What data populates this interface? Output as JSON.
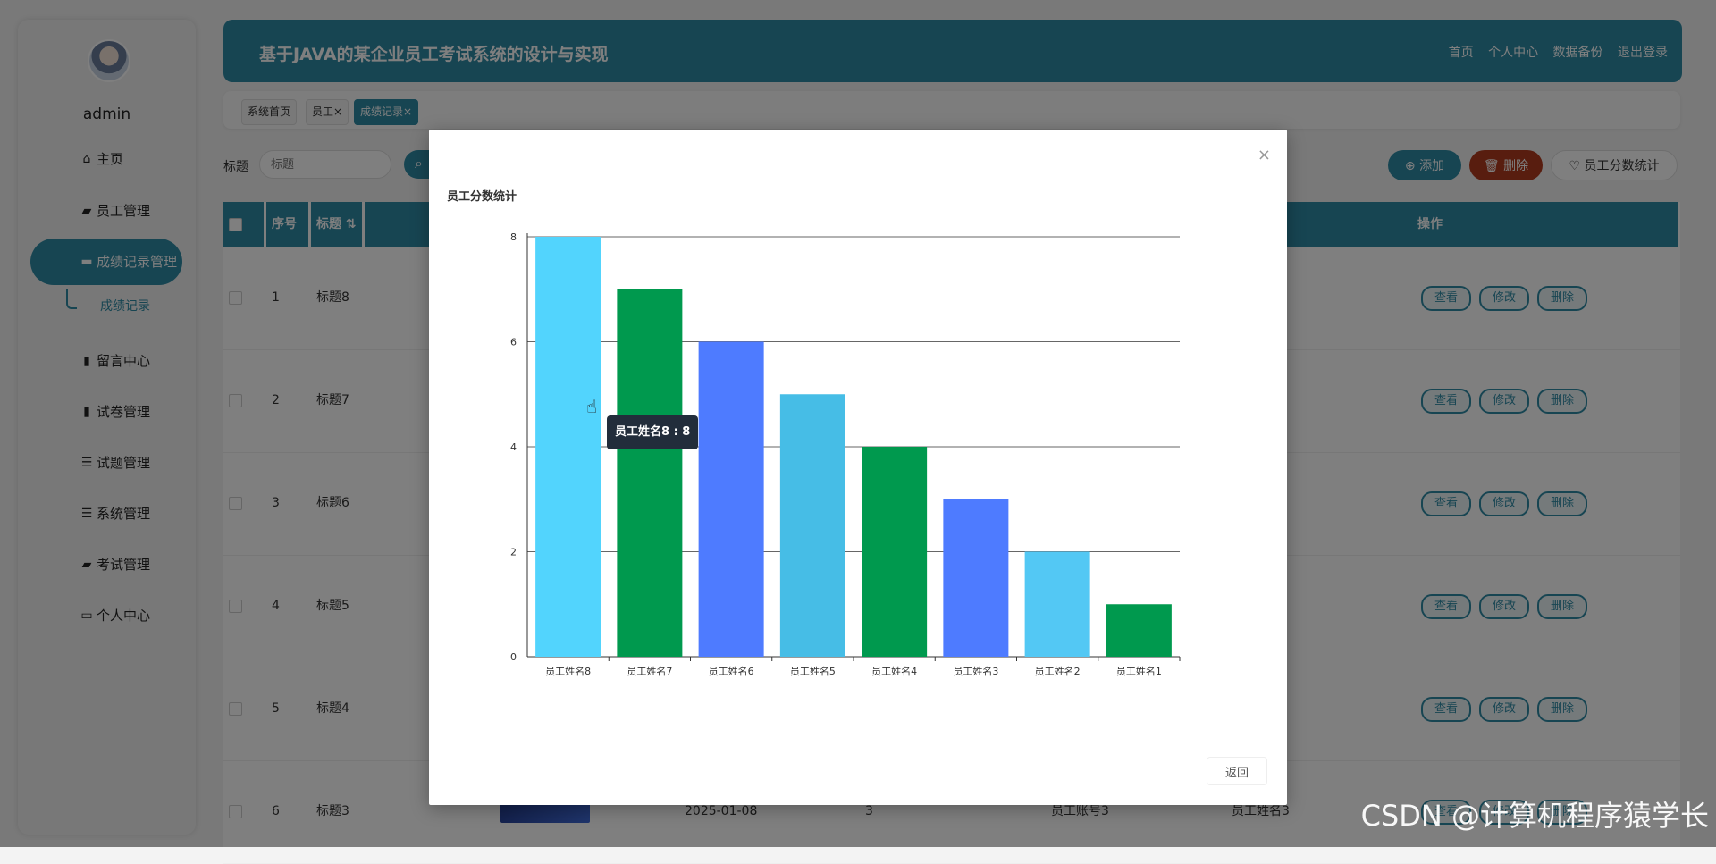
{
  "sidebar": {
    "username": "admin",
    "items": [
      {
        "label": "主页",
        "icon": "home-icon"
      },
      {
        "label": "员工管理",
        "icon": "user-icon"
      },
      {
        "label": "成绩记录管理",
        "icon": "monitor-icon"
      },
      {
        "label": "留言中心",
        "icon": "chart-icon"
      },
      {
        "label": "试卷管理",
        "icon": "book-icon"
      },
      {
        "label": "试题管理",
        "icon": "list-icon"
      },
      {
        "label": "系统管理",
        "icon": "list-icon"
      },
      {
        "label": "考试管理",
        "icon": "briefcase-icon"
      },
      {
        "label": "个人中心",
        "icon": "card-icon"
      }
    ],
    "submenu_label": "成绩记录"
  },
  "header": {
    "title": "基于JAVA的某企业员工考试系统的设计与实现",
    "nav": [
      "首页",
      "个人中心",
      "数据备份",
      "退出登录"
    ]
  },
  "tabs": [
    "系统首页",
    "员工×",
    "成绩记录×"
  ],
  "search": {
    "label": "标题",
    "placeholder": "标题"
  },
  "toolbar": {
    "add_label": "添加",
    "delete_label": "删除",
    "stat_label": "员工分数统计"
  },
  "table": {
    "headers": [
      "序号",
      "标题",
      "操作"
    ],
    "rows": [
      {
        "index": "1",
        "title": "标题8",
        "date": "",
        "score": "",
        "account": "",
        "name": ""
      },
      {
        "index": "2",
        "title": "标题7",
        "date": "",
        "score": "",
        "account": "",
        "name": ""
      },
      {
        "index": "3",
        "title": "标题6",
        "date": "",
        "score": "",
        "account": "",
        "name": ""
      },
      {
        "index": "4",
        "title": "标题5",
        "date": "",
        "score": "",
        "account": "",
        "name": ""
      },
      {
        "index": "5",
        "title": "标题4",
        "date": "",
        "score": "",
        "account": "",
        "name": ""
      },
      {
        "index": "6",
        "title": "标题3",
        "date": "2025-01-08",
        "score": "3",
        "account": "员工账号3",
        "name": "员工姓名3"
      }
    ],
    "row_actions": [
      "查看",
      "修改",
      "删除"
    ]
  },
  "modal": {
    "close": "×",
    "back_label": "返回",
    "tooltip": "员工姓名8 : 8"
  },
  "watermark": "CSDN @计算机程序猿学长",
  "colors": {
    "primary": "#2f8aa5",
    "danger": "#b03a1e"
  },
  "chart_data": {
    "type": "bar",
    "title": "员工分数统计",
    "categories": [
      "员工姓名8",
      "员工姓名7",
      "员工姓名6",
      "员工姓名5",
      "员工姓名4",
      "员工姓名3",
      "员工姓名2",
      "员工姓名1"
    ],
    "values": [
      8,
      7,
      6,
      5,
      4,
      3,
      2,
      1
    ],
    "bar_colors": [
      "#52d4fd",
      "#00994e",
      "#4e7bff",
      "#46bde6",
      "#00994e",
      "#4e7bff",
      "#53c8f4",
      "#00994e"
    ],
    "ylim": [
      0,
      8
    ],
    "yticks": [
      0,
      2,
      4,
      6,
      8
    ],
    "grid": true,
    "legend": "none"
  }
}
